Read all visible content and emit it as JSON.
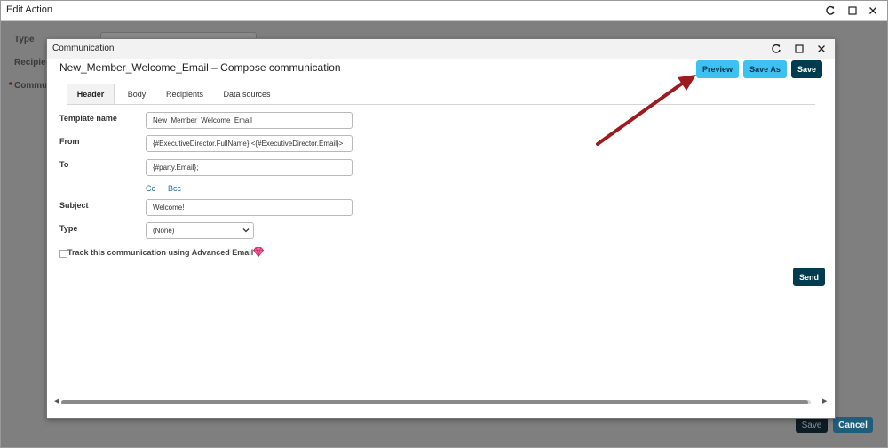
{
  "outer": {
    "title": "Edit Action",
    "labels": {
      "type": "Type",
      "recipients": "Recipien",
      "communication": "Commun"
    },
    "required_marker": "*",
    "footer": {
      "save": "Save",
      "cancel": "Cancel"
    }
  },
  "dialog": {
    "title": "Communication",
    "heading": "New_Member_Welcome_Email – Compose communication",
    "buttons": {
      "preview": "Preview",
      "save_as": "Save As",
      "save": "Save"
    },
    "tabs": [
      {
        "label": "Header",
        "active": true
      },
      {
        "label": "Body",
        "active": false
      },
      {
        "label": "Recipients",
        "active": false
      },
      {
        "label": "Data sources",
        "active": false
      }
    ],
    "fields": {
      "template_name": {
        "label": "Template name",
        "value": "New_Member_Welcome_Email"
      },
      "from": {
        "label": "From",
        "value": "{#ExecutiveDirector.FullName} <{#ExecutiveDirector.Email}>"
      },
      "to": {
        "label": "To",
        "value": "{#party.Email};"
      },
      "subject": {
        "label": "Subject",
        "value": "Welcome!"
      },
      "type": {
        "label": "Type",
        "value": "(None)"
      }
    },
    "links": {
      "cc": "Cc",
      "bcc": "Bcc"
    },
    "track_label": "Track this communication using Advanced Email",
    "track_checked": false,
    "send": "Send"
  },
  "icons": {
    "refresh": "refresh-icon",
    "maximize": "maximize-icon",
    "close": "close-icon",
    "gem": "gem-icon",
    "chevron_down": "chevron-down-icon",
    "annotation_arrow": "red-arrow"
  },
  "colors": {
    "preview_button": "#3dc1f2",
    "primary_button": "#003b4f",
    "link": "#1a6ea8",
    "arrow": "#9b1b1e",
    "overlay": "#7f7f7f"
  }
}
